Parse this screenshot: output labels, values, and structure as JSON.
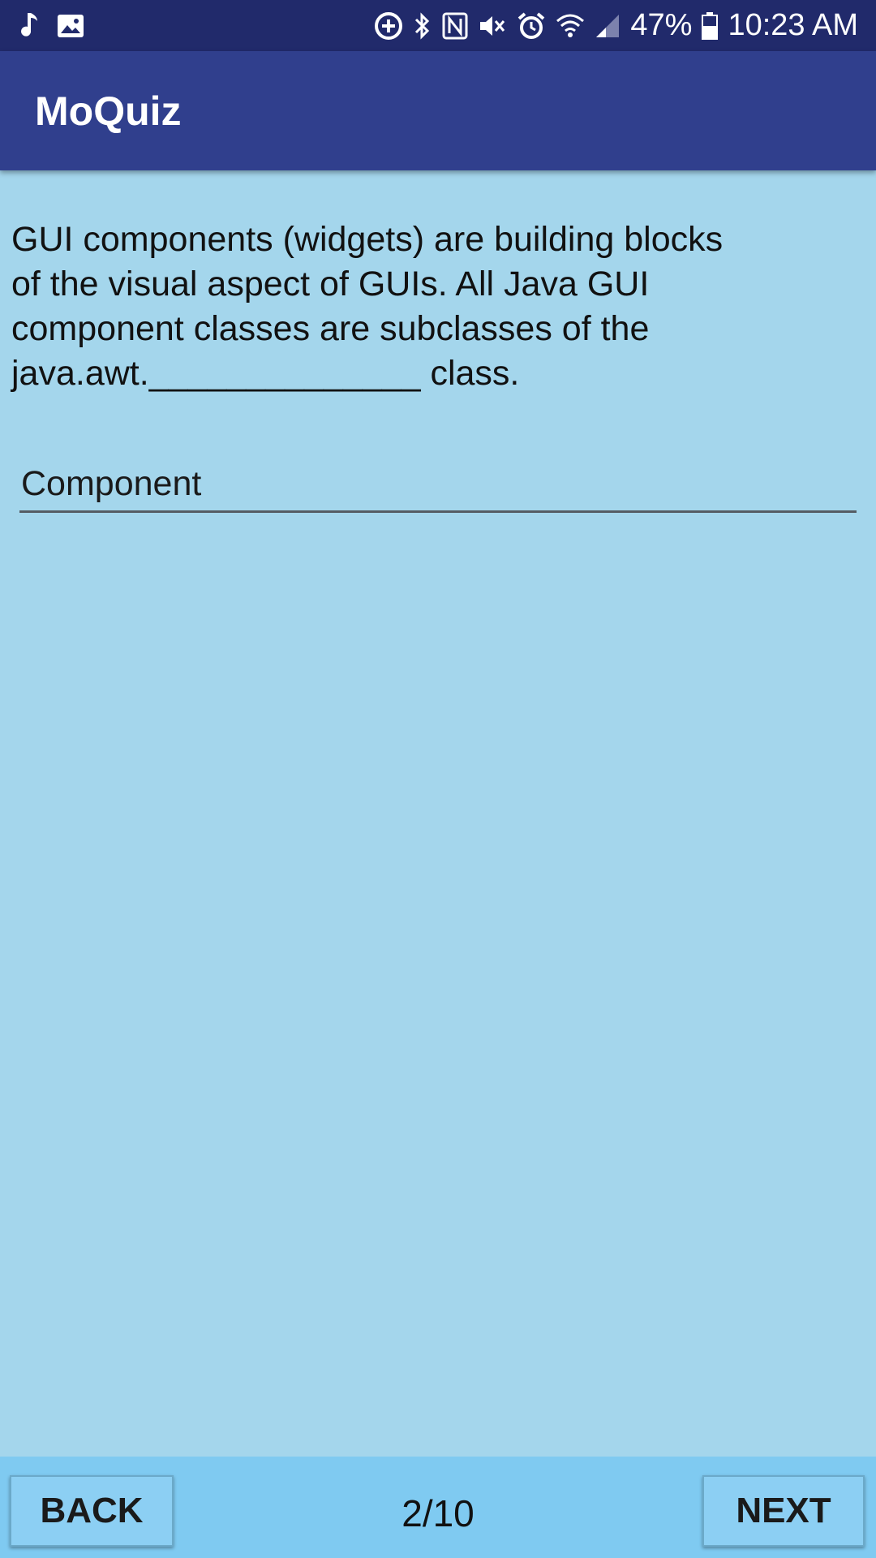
{
  "status_bar": {
    "left_icons": [
      "music-note-icon",
      "image-icon"
    ],
    "right_icons": [
      "data-saver-icon",
      "bluetooth-icon",
      "nfc-icon",
      "mute-icon",
      "alarm-icon",
      "wifi-icon",
      "signal-icon"
    ],
    "battery_percent": "47%",
    "time": "10:23 AM"
  },
  "app_bar": {
    "title": "MoQuiz"
  },
  "question": {
    "line1": "GUI components (widgets) are building blocks",
    "line2": "of the visual aspect of GUIs. All Java GUI",
    "line3": "component classes are subclasses of the",
    "line4_prefix": "java.awt.",
    "line4_blank": "______________",
    "line4_suffix": " class."
  },
  "answer": {
    "value": "Component"
  },
  "navigation": {
    "back_label": "BACK",
    "next_label": "NEXT",
    "page_indicator": "2/10"
  },
  "colors": {
    "status_bar": "#212a6b",
    "app_bar": "#303f8d",
    "background": "#a4d6ec",
    "bottom_bar": "#7fcaf1"
  }
}
